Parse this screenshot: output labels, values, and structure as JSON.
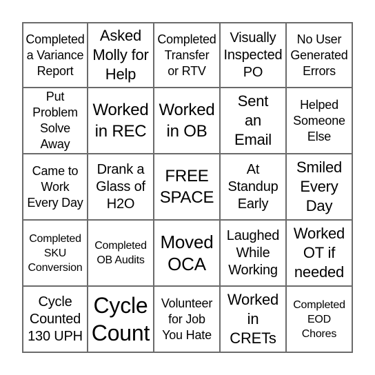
{
  "board": {
    "rows": [
      [
        {
          "text": "Completed\na Variance\nReport",
          "size": "s-sm"
        },
        {
          "text": "Asked\nMolly for\nHelp",
          "size": "s-lg"
        },
        {
          "text": "Completed\nTransfer\nor RTV",
          "size": "s-sm"
        },
        {
          "text": "Visually\nInspected\nPO",
          "size": "s-md"
        },
        {
          "text": "No User\nGenerated\nErrors",
          "size": "s-sm"
        }
      ],
      [
        {
          "text": "Put\nProblem\nSolve\nAway",
          "size": "s-sm"
        },
        {
          "text": "Worked\nin REC",
          "size": "s-xl"
        },
        {
          "text": "Worked\nin OB",
          "size": "s-xl"
        },
        {
          "text": "Sent\nan\nEmail",
          "size": "s-lg"
        },
        {
          "text": "Helped\nSomeone\nElse",
          "size": "s-sm"
        }
      ],
      [
        {
          "text": "Came to\nWork\nEvery Day",
          "size": "s-sm"
        },
        {
          "text": "Drank a\nGlass of\nH2O",
          "size": "s-md"
        },
        {
          "text": "FREE\nSPACE",
          "size": "s-xl"
        },
        {
          "text": "At\nStandup\nEarly",
          "size": "s-md"
        },
        {
          "text": "Smiled\nEvery\nDay",
          "size": "s-lg"
        }
      ],
      [
        {
          "text": "Completed\nSKU\nConversion",
          "size": "s-xs"
        },
        {
          "text": "Completed\nOB Audits",
          "size": "s-xs"
        },
        {
          "text": "Moved\nOCA",
          "size": "s-xxl"
        },
        {
          "text": "Laughed\nWhile\nWorking",
          "size": "s-md"
        },
        {
          "text": "Worked\nOT if\nneeded",
          "size": "s-lg"
        }
      ],
      [
        {
          "text": "Cycle\nCounted\n130 UPH",
          "size": "s-md"
        },
        {
          "text": "Cycle\nCount",
          "size": "s-big"
        },
        {
          "text": "Volunteer\nfor Job\nYou Hate",
          "size": "s-sm"
        },
        {
          "text": "Worked\nin\nCRETs",
          "size": "s-lg"
        },
        {
          "text": "Completed\nEOD\nChores",
          "size": "s-xs"
        }
      ]
    ]
  }
}
